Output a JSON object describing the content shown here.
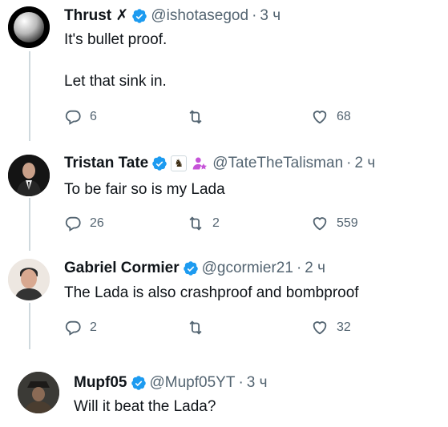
{
  "tweets": [
    {
      "name": "Thrust ✗",
      "handle": "@ishotasegod",
      "time": "3 ч",
      "text": "It's bullet proof.\n\nLet that sink in.",
      "replies": "6",
      "reposts": "",
      "likes": "68",
      "avatar": "black-ring-sphere-avatar"
    },
    {
      "name": "Tristan Tate",
      "handle": "@TateTheTalisman",
      "time": "2 ч",
      "text": "To be fair so is my Lada",
      "replies": "26",
      "reposts": "2",
      "likes": "559",
      "avatar": "man-in-suit-avatar",
      "badges": [
        "chess-knight-badge",
        "purple-person-star-badge"
      ]
    },
    {
      "name": "Gabriel Cormier",
      "handle": "@gcormier21",
      "time": "2 ч",
      "text": "The Lada is also crashproof and bombproof",
      "replies": "2",
      "reposts": "",
      "likes": "32",
      "avatar": "man-portrait-avatar"
    },
    {
      "name": "Mupf05",
      "handle": "@Mupf05YT",
      "time": "3 ч",
      "text": "Will it beat the Lada?",
      "avatar": "dark-hat-figure-avatar"
    }
  ],
  "colors": {
    "verified": "#1d9bf0",
    "secondary_text": "#536471",
    "thread_line": "#cfd9de",
    "purple_badge": "#c653d8"
  }
}
